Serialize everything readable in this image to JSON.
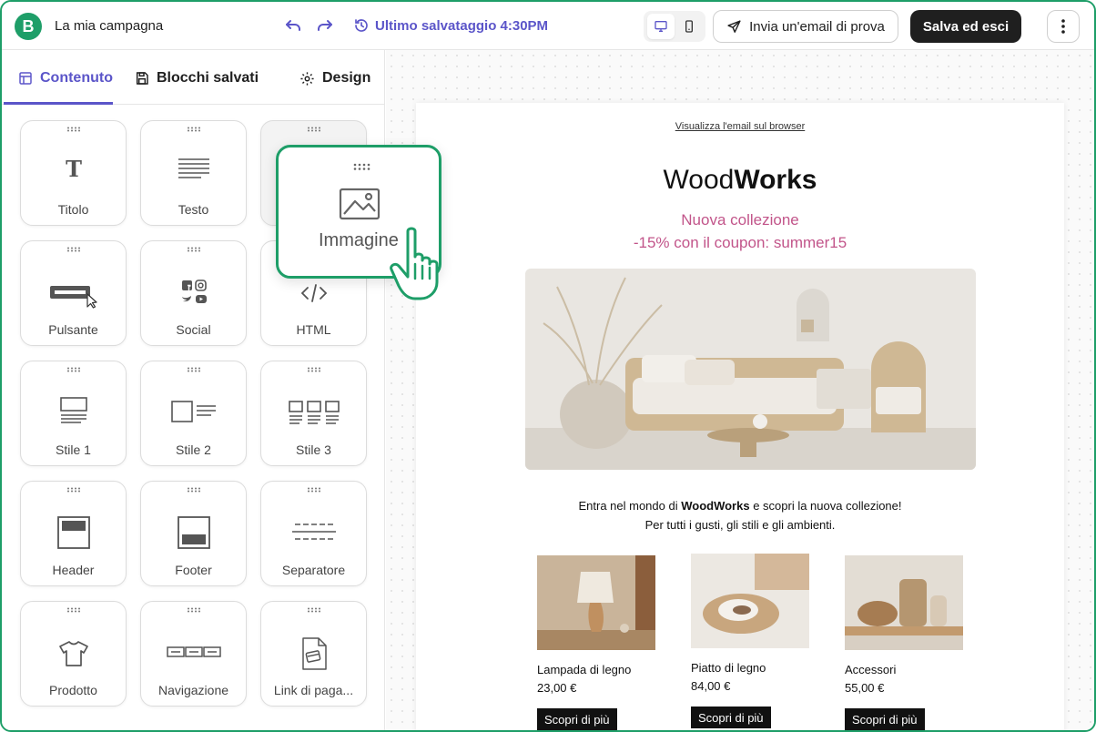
{
  "header": {
    "logo_letter": "B",
    "campaign_title": "La mia campagna",
    "saved_status": "Ultimo salvataggio 4:30PM",
    "test_email_label": "Invia un'email di prova",
    "save_exit_label": "Salva ed esci",
    "accent_color": "#5b55c9",
    "brand_color": "#1e9e68"
  },
  "tabs": [
    {
      "label": "Contenuto",
      "icon": "layout-icon",
      "active": true
    },
    {
      "label": "Blocchi salvati",
      "icon": "save-icon",
      "active": false
    },
    {
      "label": "Design",
      "icon": "gear-icon",
      "active": false
    }
  ],
  "blocks": [
    {
      "label": "Titolo",
      "icon": "title-icon"
    },
    {
      "label": "Testo",
      "icon": "text-icon"
    },
    {
      "label": "",
      "icon": "image-icon"
    },
    {
      "label": "Pulsante",
      "icon": "button-icon"
    },
    {
      "label": "Social",
      "icon": "social-icon"
    },
    {
      "label": "HTML",
      "icon": "code-icon"
    },
    {
      "label": "Stile 1",
      "icon": "style1-icon"
    },
    {
      "label": "Stile 2",
      "icon": "style2-icon"
    },
    {
      "label": "Stile 3",
      "icon": "style3-icon"
    },
    {
      "label": "Header",
      "icon": "header-icon"
    },
    {
      "label": "Footer",
      "icon": "footer-icon"
    },
    {
      "label": "Separatore",
      "icon": "divider-icon"
    },
    {
      "label": "Prodotto",
      "icon": "tshirt-icon"
    },
    {
      "label": "Navigazione",
      "icon": "navigation-icon"
    },
    {
      "label": "Link di paga...",
      "icon": "payment-link-icon"
    }
  ],
  "drag_card": {
    "label": "Immagine",
    "icon": "image-icon"
  },
  "email": {
    "view_in_browser": "Visualizza l'email sul browser",
    "brand_regular": "Wood",
    "brand_bold": "Works",
    "promo_line1": "Nuova collezione",
    "promo_line2": "-15% con il coupon: summer15",
    "intro_pre": "Entra nel mondo di ",
    "intro_bold": "WoodWorks",
    "intro_post": " e scopri la nuova collezione!",
    "intro_line2": "Per tutti i gusti, gli stili e gli ambienti.",
    "promo_color": "#c2558a",
    "products": [
      {
        "name": "Lampada di legno",
        "price": "23,00 €",
        "cta": "Scopri di più"
      },
      {
        "name": "Piatto di legno",
        "price": "84,00 €",
        "cta": "Scopri di più"
      },
      {
        "name": "Accessori",
        "price": "55,00 €",
        "cta": "Scopri di più"
      }
    ]
  }
}
